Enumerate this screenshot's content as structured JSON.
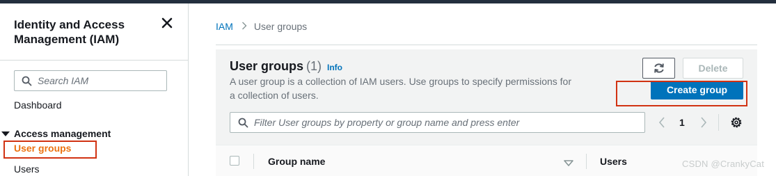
{
  "sidebar": {
    "title": "Identity and Access Management (IAM)",
    "search_placeholder": "Search IAM",
    "dashboard_label": "Dashboard",
    "section_label": "Access management",
    "items": [
      {
        "label": "User groups",
        "active": true
      },
      {
        "label": "Users",
        "active": false
      }
    ]
  },
  "breadcrumb": {
    "root": "IAM",
    "current": "User groups"
  },
  "panel": {
    "title": "User groups",
    "count": "(1)",
    "info_label": "Info",
    "description": "A user group is a collection of IAM users. Use groups to specify permissions for a collection of users.",
    "delete_label": "Delete",
    "create_label": "Create group",
    "filter_placeholder": "Filter User groups by property or group name and press enter",
    "page_number": "1"
  },
  "table": {
    "columns": [
      "Group name",
      "Users"
    ]
  },
  "watermark": "CSDN @CrankyCat",
  "colors": {
    "accent": "#0073bb",
    "active_nav": "#ec7211",
    "highlight": "#d13212",
    "topbar": "#232f3e"
  },
  "icons": [
    "close-icon",
    "search-icon",
    "refresh-icon",
    "chevron-left-icon",
    "chevron-right-icon",
    "gear-icon",
    "sort-down-icon",
    "caret-down-icon"
  ]
}
